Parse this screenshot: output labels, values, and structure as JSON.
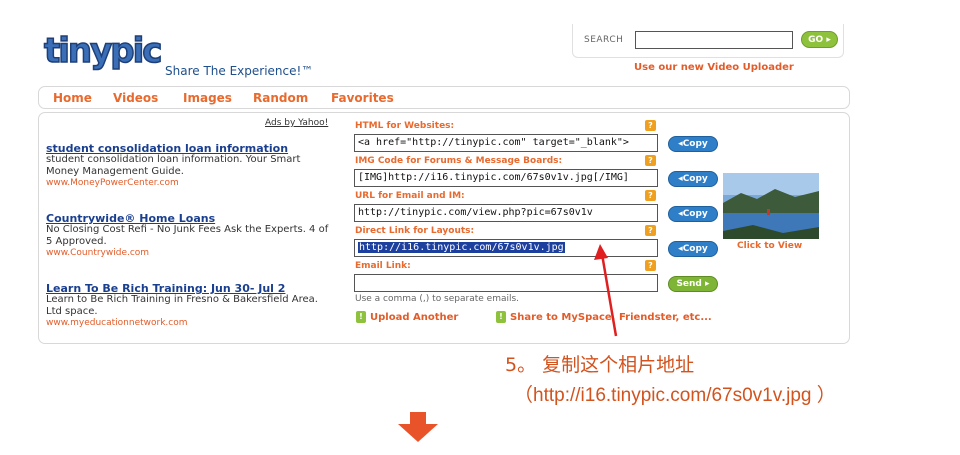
{
  "logo": {
    "wordmark": "tinypic",
    "tagline": "Share The Experience!™"
  },
  "search": {
    "label": "SEARCH",
    "value": "",
    "go_label": "GO",
    "video_link": "Use our new Video Uploader"
  },
  "nav": {
    "items": [
      "Home",
      "Videos",
      "Images",
      "Random",
      "Favorites"
    ]
  },
  "ads": {
    "ads_by": "Ads by Yahoo!",
    "items": [
      {
        "title": "student consolidation loan information",
        "desc": "student consolidation loan information. Your Smart Money Management Guide.",
        "url": "www.MoneyPowerCenter.com"
      },
      {
        "title": "Countrywide® Home Loans",
        "desc": "No Closing Cost Refi - No Junk Fees Ask the Experts. 4 of 5 Approved.",
        "url": "www.Countrywide.com"
      },
      {
        "title": "Learn To Be Rich Training: Jun 30- Jul 2",
        "desc": "Learn to Be Rich Training in Fresno & Bakersfield Area. Ltd space.",
        "url": "www.myeducationnetwork.com"
      }
    ]
  },
  "codes": {
    "html_label": "HTML for Websites:",
    "html_value": "<a href=\"http://tinypic.com\" target=\"_blank\">",
    "img_label": "IMG Code for Forums & Message Boards:",
    "img_value": "[IMG]http://i16.tinypic.com/67s0v1v.jpg[/IMG]",
    "url_label": "URL for Email and IM:",
    "url_value": "http://tinypic.com/view.php?pic=67s0v1v",
    "direct_label": "Direct Link for Layouts:",
    "direct_value": "http://i16.tinypic.com/67s0v1v.jpg",
    "email_label": "Email Link:",
    "email_value": "",
    "help_glyph": "?",
    "copy_label": "Copy",
    "send_label": "Send",
    "email_hint": "Use a comma (,) to separate emails.",
    "upload_another": "Upload Another",
    "share_link": "Share to MySpace, Friendster, etc..."
  },
  "thumbnail": {
    "caption": "Click to View"
  },
  "annotation": {
    "step_text": "5。 复制这个相片地址",
    "url_text": "（http://i16.tinypic.com/67s0v1v.jpg ）",
    "color": "#d2531e"
  },
  "colors": {
    "accent": "#e86a2e",
    "link": "#1a3f8f",
    "copy_button": "#2f7fc8",
    "go_button": "#8fc23c"
  }
}
